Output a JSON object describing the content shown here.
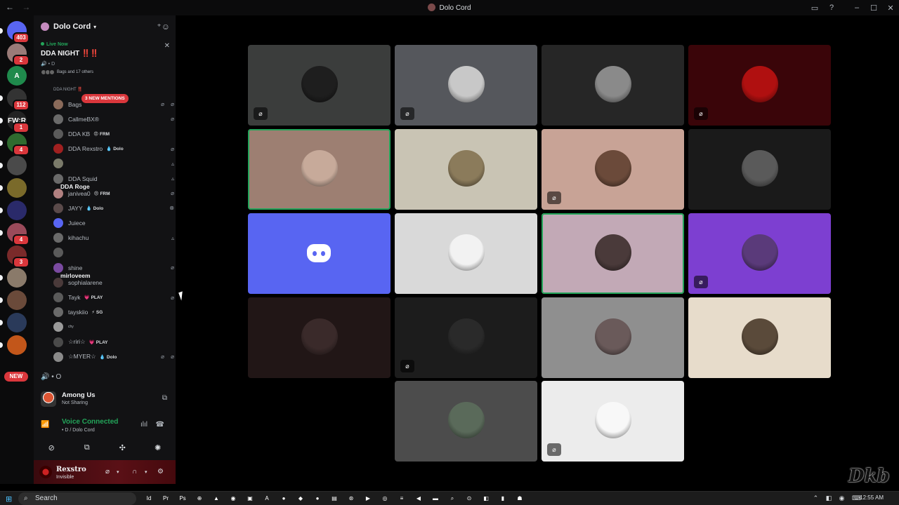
{
  "window": {
    "title": "Dolo Cord",
    "nav_back": "←",
    "nav_forward": "→",
    "controls": [
      "▭",
      "?",
      "–",
      "☐",
      "✕"
    ]
  },
  "rail": {
    "servers": [
      {
        "label": "",
        "badge": "403",
        "color": "#5865f2",
        "pip": true
      },
      {
        "label": "",
        "badge": "2",
        "color": "#9a7b78",
        "pip": false
      },
      {
        "label": "A",
        "badge": "",
        "color": "#1f8a4c",
        "pip": false
      },
      {
        "label": "",
        "badge": "112",
        "color": "#333333",
        "pip": true
      },
      {
        "label": "FW:R",
        "badge": "1",
        "color": "#222222",
        "pip": true
      },
      {
        "label": "",
        "badge": "4",
        "color": "#2f6b2f",
        "pip": true
      },
      {
        "label": "",
        "badge": "",
        "color": "#4a4a4a",
        "pip": true
      },
      {
        "label": "",
        "badge": "",
        "color": "#7a6a2a",
        "pip": true
      },
      {
        "label": "",
        "badge": "",
        "color": "#2a2a6a",
        "pip": true
      },
      {
        "label": "",
        "badge": "4",
        "color": "#9a4a5a",
        "pip": true
      },
      {
        "label": "",
        "badge": "3",
        "color": "#7a2a2a",
        "pip": false
      },
      {
        "label": "",
        "badge": "",
        "color": "#8a7a6a",
        "pip": true
      },
      {
        "label": "",
        "badge": "",
        "color": "#6a4a3a",
        "pip": true
      },
      {
        "label": "",
        "badge": "",
        "color": "#2a3a5a",
        "pip": true
      },
      {
        "label": "",
        "badge": "",
        "color": "#c2561a",
        "pip": true
      }
    ],
    "new_label": "NEW"
  },
  "sidebar": {
    "server_name": "Dolo Cord",
    "live": {
      "live_now": "Live Now",
      "event_name": "DDA NIGHT",
      "event_marks": "‼️‼️",
      "sub": "• D",
      "attendees": "Bags and 17 others"
    },
    "channel_name": "DDA NIGHT ‼️",
    "mentions": "3 NEW MENTIONS",
    "members": [
      {
        "name": "Bags",
        "tag": "",
        "tag_icon": "",
        "icons": [
          "⌀",
          "⌀"
        ],
        "color": "#8a6a5a",
        "live": false
      },
      {
        "name": "CallmeBX®",
        "tag": "",
        "tag_icon": "",
        "icons": [
          "⌀"
        ],
        "color": "#6a6a6a",
        "live": false
      },
      {
        "name": "DDA KB",
        "tag": "FRM",
        "tag_icon": "😠",
        "icons": [],
        "color": "#5a5a5a",
        "live": false
      },
      {
        "name": "DDA Rexstro",
        "tag": "Dolo",
        "tag_icon": "💧",
        "icons": [
          "⌀"
        ],
        "color": "#a02020",
        "live": false
      },
      {
        "name": "DDA Roge",
        "tag": "",
        "tag_icon": "",
        "icons": [
          "▵"
        ],
        "color": "#7a7a6a",
        "live": true
      },
      {
        "name": "DDA Squid",
        "tag": "",
        "tag_icon": "",
        "icons": [
          "▵"
        ],
        "color": "#6a6a6a",
        "live": false
      },
      {
        "name": "janivea0",
        "tag": "FRM",
        "tag_icon": "😠",
        "icons": [
          "⌀"
        ],
        "color": "#b08080",
        "live": false
      },
      {
        "name": "JAYY",
        "tag": "Dolo",
        "tag_icon": "💧",
        "icons": [
          "⊗"
        ],
        "color": "#5a4a4a",
        "live": false
      },
      {
        "name": "Juiece",
        "tag": "",
        "tag_icon": "",
        "icons": [],
        "color": "#5865f2",
        "live": false
      },
      {
        "name": "kihachu",
        "tag": "",
        "tag_icon": "",
        "icons": [
          "▵"
        ],
        "color": "#6a6a6a",
        "live": false
      },
      {
        "name": "mirloveem",
        "tag": "",
        "tag_icon": "",
        "icons": [],
        "color": "#5a5a5a",
        "live": true
      },
      {
        "name": "shine",
        "tag": "",
        "tag_icon": "",
        "icons": [
          "⌀"
        ],
        "color": "#7a4aa0",
        "live": false
      },
      {
        "name": "sophialarene",
        "tag": "",
        "tag_icon": "",
        "icons": [],
        "color": "#4a3a3a",
        "live": false
      },
      {
        "name": "Tayk",
        "tag": "PLAY",
        "tag_icon": "💗",
        "icons": [
          "⌀"
        ],
        "color": "#5a5a5a",
        "live": false
      },
      {
        "name": "tayskiio",
        "tag": "SG",
        "tag_icon": "⚡",
        "icons": [],
        "color": "#6a6a6a",
        "live": false
      },
      {
        "name": "chy",
        "tag": "",
        "tag_icon": "",
        "icons": [],
        "color": "#9a9a9a",
        "live": false
      },
      {
        "name": "☆riri☆",
        "tag": "PLAY",
        "tag_icon": "💗",
        "icons": [],
        "color": "#4a4a4a",
        "live": false
      },
      {
        "name": "☆MYER☆",
        "tag": "Dolo",
        "tag_icon": "💧",
        "icons": [
          "⌀",
          "⌀"
        ],
        "color": "#8a8a8a",
        "live": false
      }
    ],
    "voice_status": "• O",
    "activity": {
      "game": "Among Us",
      "status": "Not Sharing"
    },
    "voice": {
      "title": "Voice Connected",
      "sub": "• D / Dolo Cord"
    },
    "user": {
      "name": "Rexstro",
      "status": "Invisible"
    }
  },
  "stage": {
    "tiles": [
      {
        "bg": "#3b3d3c",
        "avatar": "#1e1e1e",
        "muted": true,
        "speaking": false
      },
      {
        "bg": "#55575c",
        "avatar": "#c8c8c8",
        "muted": true,
        "speaking": false
      },
      {
        "bg": "#262626",
        "avatar": "#8a8a8a",
        "muted": false,
        "speaking": false
      },
      {
        "bg": "#3a0509",
        "avatar": "#b01010",
        "muted": true,
        "speaking": false
      },
      {
        "bg": "#9d7f72",
        "avatar": "#c7aa9a",
        "muted": false,
        "speaking": true
      },
      {
        "bg": "#c9c4b4",
        "avatar": "#8b7b5b",
        "muted": false,
        "speaking": false
      },
      {
        "bg": "#c8a396",
        "avatar": "#6b4a3a",
        "muted": true,
        "speaking": false
      },
      {
        "bg": "#1a1a1a",
        "avatar": "#5a5a5a",
        "muted": false,
        "speaking": false
      },
      {
        "bg": "#5865f2",
        "avatar": "",
        "muted": false,
        "speaking": false,
        "logo": true
      },
      {
        "bg": "#d9d9d9",
        "avatar": "#f2f2f2",
        "muted": false,
        "speaking": false
      },
      {
        "bg": "#c2a9b6",
        "avatar": "#4a3a3a",
        "muted": false,
        "speaking": true
      },
      {
        "bg": "#7d3fd1",
        "avatar": "#5a3a7a",
        "muted": true,
        "speaking": false
      },
      {
        "bg": "#211616",
        "avatar": "#3a2a2a",
        "muted": false,
        "speaking": false
      },
      {
        "bg": "#1c1c1c",
        "avatar": "#2a2a2a",
        "muted": true,
        "speaking": false
      },
      {
        "bg": "#8f8f8f",
        "avatar": "#6a5a5a",
        "muted": false,
        "speaking": false
      },
      {
        "bg": "#e7dccb",
        "avatar": "#5a4a3a",
        "muted": false,
        "speaking": false
      },
      {
        "bg": "#4c4c4c",
        "avatar": "#5a6a5a",
        "muted": false,
        "speaking": false
      },
      {
        "bg": "#ececec",
        "avatar": "#f8f8f8",
        "muted": true,
        "speaking": false
      }
    ]
  },
  "taskbar": {
    "search": "Search",
    "apps": [
      "Id",
      "Pr",
      "Ps",
      "⊕",
      "▲",
      "◉",
      "▣",
      "A",
      "●",
      "◆",
      "●",
      "▤",
      "⊛",
      "▶",
      "◎",
      "≡",
      "◀",
      "▬",
      "⌕",
      "⊙",
      "◧",
      "▮",
      "☗"
    ],
    "tray": "⌃ ◧ ◉ ⌨",
    "time": "12:55 AM"
  },
  "watermark": "Dkb"
}
